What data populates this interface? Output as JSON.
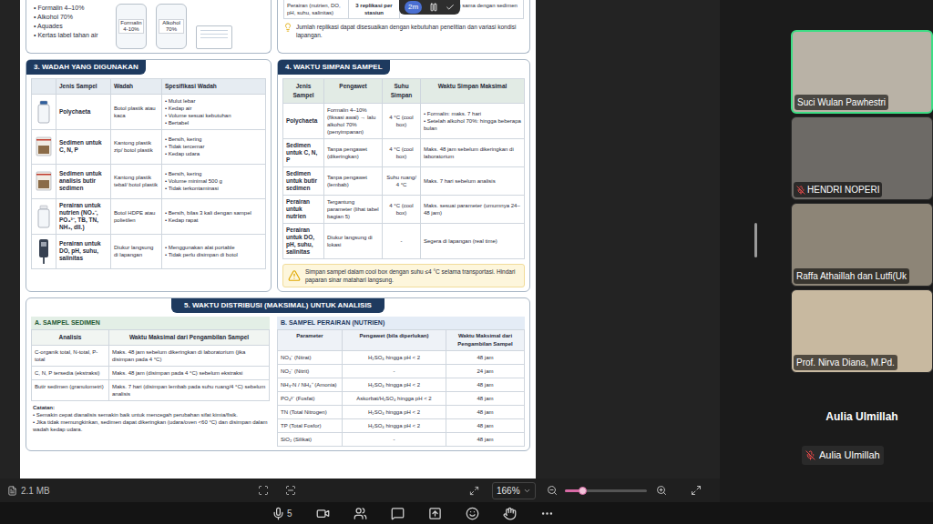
{
  "share_controls": {
    "timer": "2m"
  },
  "document": {
    "top_section": {
      "materials": [
        "• Formalin 4–10%",
        "• Alkohol 70%",
        "• Aquades",
        "• Kertas label tahan air"
      ],
      "bottle_labels": [
        "Formalin 4-10%",
        "Alkohol 70%"
      ],
      "replication_row": [
        "Perairan (nutrien, DO, pH, suhu, salinitas)",
        "3 replikasi per stasiun",
        "Diambil pada titik yang sama dengan sedimen"
      ],
      "note": "Jumlah replikasi dapat disesuaikan dengan kebutuhan penelitian dan variasi kondisi lapangan."
    },
    "section3": {
      "title": "3. WADAH YANG DIGUNAKAN",
      "columns": [
        "Jenis Sampel",
        "Wadah",
        "Spesifikasi Wadah"
      ],
      "rows": [
        {
          "sample": "Polychaeta",
          "container": "Botol plastik atau kaca",
          "specs": [
            "• Mulut lebar",
            "• Kedap air",
            "• Volume sesuai kebutuhan",
            "• Bertabel"
          ]
        },
        {
          "sample": "Sedimen untuk C, N, P",
          "container": "Kantong plastik zip/ botol plastik",
          "specs": [
            "• Bersih, kering",
            "• Tidak tercemar",
            "• Kedap udara"
          ]
        },
        {
          "sample": "Sedimen untuk analisis butir sedimen",
          "container": "Kantong plastik tebal/ botol plastik",
          "specs": [
            "• Bersih, kering",
            "• Volume minimal 500 g",
            "• Tidak terkontaminasi"
          ]
        },
        {
          "sample": "Perairan untuk nutrien (NO₃⁻, PO₄³⁻, TB, TN, NH₃, dll.)",
          "container": "Botol HDPE atau polietilen",
          "specs": [
            "• Bersih, bilas 3 kali dengan sampel",
            "• Kedap rapat"
          ]
        },
        {
          "sample": "Perairan untuk DO, pH, suhu, salinitas",
          "container": "Diukur langsung di lapangan",
          "specs": [
            "• Menggunakan alat portable",
            "• Tidak perlu disimpan di botol"
          ]
        }
      ]
    },
    "section4": {
      "title": "4. WAKTU SIMPAN SAMPEL",
      "columns": [
        "Jenis Sampel",
        "Pengawet",
        "Suhu Simpan",
        "Waktu Simpan Maksimal"
      ],
      "rows": [
        {
          "sample": "Polychaeta",
          "preservative": "Formalin 4–10% (fiksasi awal) → lalu alkohol 70% (penyimpanan)",
          "temp": "4 °C (cool box)",
          "max": [
            "• Formalin: maks. 7 hari",
            "• Setelah alkohol 70%: hingga beberapa bulan"
          ]
        },
        {
          "sample": "Sedimen untuk C, N, P",
          "preservative": "Tanpa pengawet (dikeringkan)",
          "temp": "4 °C (cool box)",
          "max": [
            "Maks. 48 jam sebelum dikeringkan di laboratorium"
          ]
        },
        {
          "sample": "Sedimen untuk butir sedimen",
          "preservative": "Tanpa pengawet (lembab)",
          "temp": "Suhu ruang/ 4 °C",
          "max": [
            "Maks. 7 hari sebelum analisis"
          ]
        },
        {
          "sample": "Perairan untuk nutrien",
          "preservative": "Tergantung parameter (lihat tabel bagian 5)",
          "temp": "4 °C (cool box)",
          "max": [
            "Maks. sesuai parameter (umumnya 24–48 jam)"
          ]
        },
        {
          "sample": "Perairan untuk DO, pH, suhu, salinitas",
          "preservative": "Diukur langsung di lokasi",
          "temp": "-",
          "max": [
            "Segera di lapangan (real time)"
          ]
        }
      ],
      "note": "Simpan sampel dalam cool box dengan suhu ≤4 °C selama transportasi. Hindari paparan sinar matahari langsung."
    },
    "section5": {
      "title": "5. WAKTU DISTRIBUSI (MAKSIMAL) UNTUK ANALISIS",
      "sediment": {
        "title": "A. SAMPEL SEDIMEN",
        "columns": [
          "Analisis",
          "Waktu Maksimal dari Pengambilan Sampel"
        ],
        "rows": [
          [
            "C-organik total, N-total, P-total",
            "Maks. 48 jam sebelum dikeringkan di laboratorium (jika disimpan pada 4 °C)"
          ],
          [
            "C, N, P tersedia (ekstraksi)",
            "Maks. 48 jam (disimpan pada 4 °C) sebelum ekstraksi"
          ],
          [
            "Butir sedimen (granulometri)",
            "Maks. 7 hari (disimpan lembab pada suhu ruang/4 °C) sebelum analisis"
          ]
        ],
        "notes_title": "Catatan:",
        "notes": [
          "• Semakin cepat dianalisis semakin baik untuk mencegah perubahan sifat kimia/fisik.",
          "• Jika tidak memungkinkan, sedimen dapat dikeringkan (udara/oven <60 °C) dan disimpan dalam wadah kedap udara."
        ]
      },
      "water": {
        "title": "B. SAMPEL PERAIRAN (NUTRIEN)",
        "columns": [
          "Parameter",
          "Pengawet (bila diperlukan)",
          "Waktu Maksimal dari Pengambilan Sampel"
        ],
        "rows": [
          [
            "NO₃⁻ (Nitrat)",
            "H₂SO₄ hingga pH < 2",
            "48 jam"
          ],
          [
            "NO₂⁻ (Nitrit)",
            "-",
            "24 jam"
          ],
          [
            "NH₃-N / NH₄⁺ (Amonia)",
            "H₂SO₄ hingga pH < 2",
            "48 jam"
          ],
          [
            "PO₄³⁻ (Fosfat)",
            "Askorbat/H₂SO₄ hingga pH < 2",
            "48 jam"
          ],
          [
            "TN (Total Nitrogen)",
            "H₂SO₄ hingga pH < 2",
            "48 jam"
          ],
          [
            "TP (Total Fosfor)",
            "H₂SO₄ hingga pH < 2",
            "48 jam"
          ],
          [
            "SiO₂ (Silikat)",
            "-",
            "48 jam"
          ]
        ]
      }
    }
  },
  "viewer_bar": {
    "file_size": "2.1 MB",
    "zoom": "166%",
    "zoom_level": 0.22
  },
  "participants": [
    {
      "name": "Suci Wulan Pawhestri",
      "muted": false,
      "speaking": true
    },
    {
      "name": "HENDRI NOPERI",
      "muted": true,
      "speaking": false
    },
    {
      "name": "Raffa Athaillah dan Lutfi(Uk",
      "muted": false,
      "speaking": false
    },
    {
      "name": "Prof. Nirva Diana, M.Pd.",
      "muted": false,
      "speaking": false
    }
  ],
  "active_speaker": {
    "name": "Aulia Ulmillah"
  },
  "self_view": {
    "name": "Aulia Ulmillah",
    "muted": true
  },
  "toolbar": {
    "count": "5"
  }
}
